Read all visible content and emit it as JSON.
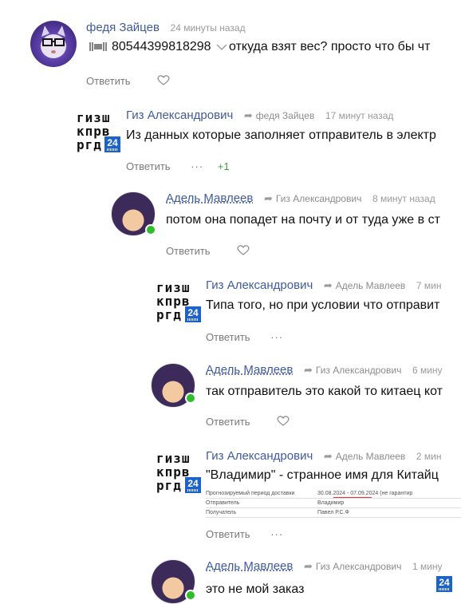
{
  "comments": [
    {
      "author": "федя Зайцев",
      "time": "24 минуты назад",
      "track": "80544399818298",
      "text": "откуда взят вес? просто что бы чт",
      "reply_label": "Ответить"
    },
    {
      "author": "Гиз Александрович",
      "reply_to": "федя Зайцев",
      "time": "17 минут назад",
      "text": "Из данных которые заполняет отправитель в электр",
      "reply_label": "Ответить",
      "more": "···",
      "likes": "+1"
    },
    {
      "author": "Адель Мавлеев",
      "reply_to": "Гиз Александрович",
      "time": "8 минут назад",
      "text": "потом она попадет на почту и от туда уже в ст",
      "reply_label": "Ответить"
    },
    {
      "author": "Гиз Александрович",
      "reply_to": "Адель Мавлеев",
      "time": "7 мин",
      "text": "Типа того, но при условии что отправит",
      "reply_label": "Ответить",
      "more": "···"
    },
    {
      "author": "Адель Мавлеев",
      "reply_to": "Гиз Александрович",
      "time": "6 мину",
      "text": "так отправитель это какой то китаец кот",
      "reply_label": "Ответить"
    },
    {
      "author": "Гиз Александрович",
      "reply_to": "Адель Мавлеев",
      "time": "2 мин",
      "text": "\"Владимир\" - странное имя для Китайц",
      "reply_label": "Ответить",
      "more": "···",
      "attachment": {
        "row1_left": "Прогнозируемый период доставки",
        "row1_right": "30.08.2024 - 07.09.2024 (не гарантир",
        "row2_left": "Отправитель",
        "row2_right": "Владимир",
        "row3_left": "Получатель",
        "row3_right": "Павел Р.С.Ф"
      }
    },
    {
      "author": "Адель Мавлеев",
      "reply_to": "Гиз Александрович",
      "time": "1 мину",
      "text": "это не мой заказ"
    }
  ],
  "avatar_text": "гизш\nкпрв\nргд",
  "badge": "24"
}
